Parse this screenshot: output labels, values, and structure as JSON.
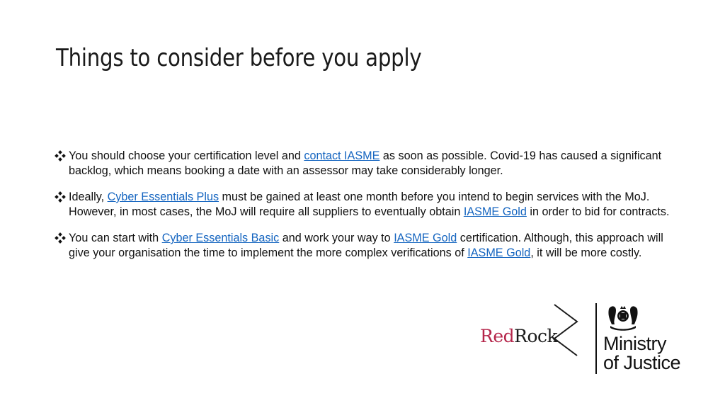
{
  "slide": {
    "title": "Things to consider before you apply"
  },
  "bullets": [
    {
      "icon": "diamond-bullet-icon",
      "parts": [
        {
          "text": "You should choose your certification level and ",
          "link": false
        },
        {
          "text": "contact IASME",
          "link": true
        },
        {
          "text": " as soon as possible. Covid-19 has caused a significant backlog, which means booking a date with an assessor may take considerably longer.",
          "link": false
        }
      ]
    },
    {
      "icon": "diamond-bullet-icon",
      "parts": [
        {
          "text": "Ideally, ",
          "link": false
        },
        {
          "text": "Cyber Essentials Plus",
          "link": true
        },
        {
          "text": " must be gained at least one month before you intend to begin services with the MoJ. However, in most cases, the MoJ will require all suppliers to eventually obtain ",
          "link": false
        },
        {
          "text": "IASME Gold",
          "link": true
        },
        {
          "text": " in order to bid for contracts.",
          "link": false
        }
      ]
    },
    {
      "icon": "diamond-bullet-icon",
      "parts": [
        {
          "text": "You can start with ",
          "link": false
        },
        {
          "text": "Cyber Essentials Basic",
          "link": true
        },
        {
          "text": " and work your way to ",
          "link": false
        },
        {
          "text": "IASME Gold",
          "link": true
        },
        {
          "text": " certification. Although, this approach will give your organisation the time to implement the more complex verifications of ",
          "link": false
        },
        {
          "text": "IASME Gold",
          "link": true
        },
        {
          "text": ", it will be more costly.",
          "link": false
        }
      ]
    }
  ],
  "logos": {
    "redrock": {
      "red_part": "Red",
      "dark_part": "Rock",
      "red_color": "#b5254a"
    },
    "moj": {
      "line1": "Ministry",
      "line2": "of Justice"
    }
  },
  "colors": {
    "link": "#1565c0",
    "text": "#111111"
  }
}
